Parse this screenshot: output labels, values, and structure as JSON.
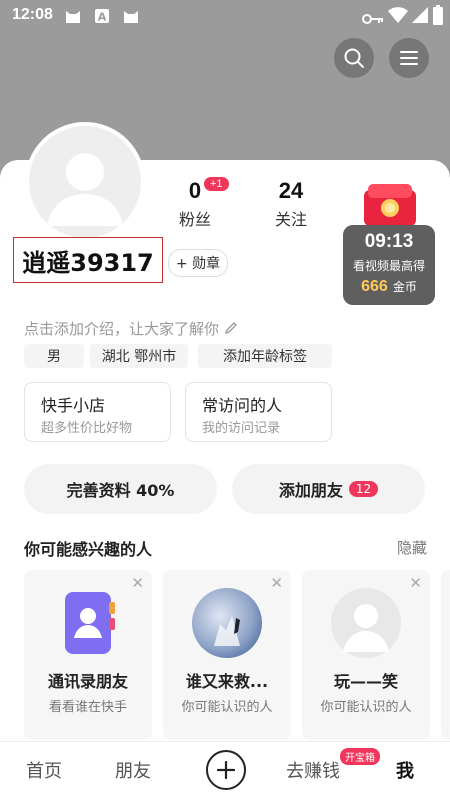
{
  "status_bar": {
    "time": "12:08"
  },
  "profile": {
    "username": "逍遥39317",
    "medal_label": "+ 勋章",
    "fans_count": "0",
    "fans_badge": "+1",
    "fans_label": "粉丝",
    "following_count": "24",
    "following_label": "关注",
    "bio_placeholder": "点击添加介绍，让大家了解你",
    "tags": [
      "男",
      "湖北 鄂州市",
      "添加年龄标签"
    ]
  },
  "reward_timer": {
    "time": "09:13",
    "caption": "看视频最高得",
    "amount": "666",
    "unit": "金币"
  },
  "shortcuts": [
    {
      "title": "快手小店",
      "subtitle": "超多性价比好物"
    },
    {
      "title": "常访问的人",
      "subtitle": "我的访问记录"
    }
  ],
  "actions": {
    "complete_profile": "完善资料 40%",
    "add_friends": "添加朋友",
    "add_friends_badge": "12"
  },
  "recommendations": {
    "title": "你可能感兴趣的人",
    "hide_label": "隐藏",
    "cards": [
      {
        "name": "通讯录朋友",
        "subtitle": "看看谁在快手"
      },
      {
        "name": "谁又来救...",
        "subtitle": "你可能认识的人"
      },
      {
        "name": "玩——笑",
        "subtitle": "你可能认识的人"
      }
    ]
  },
  "bottom_nav": {
    "home": "首页",
    "friends": "朋友",
    "earn": "去赚钱",
    "earn_badge": "开宝箱",
    "me": "我"
  },
  "colors": {
    "accent": "#f0365b",
    "header_bg": "#9b9b9b",
    "timer_amount": "#ffc85a"
  }
}
